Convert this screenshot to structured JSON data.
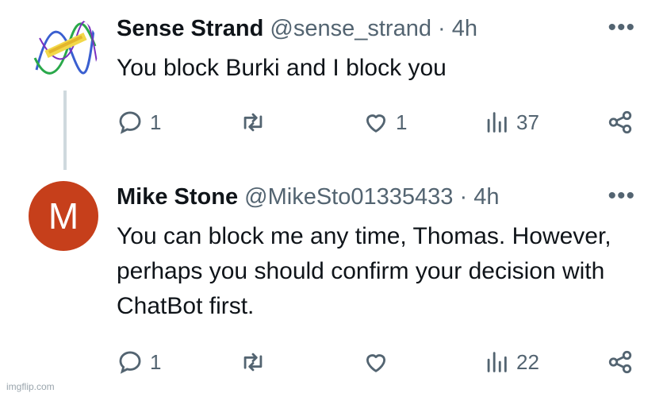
{
  "tweets": [
    {
      "name": "Sense Strand",
      "handle": "@sense_strand",
      "separator": "·",
      "time": "4h",
      "text": "You block Burki and I block you",
      "more": "•••",
      "replies": "1",
      "retweets": "",
      "likes": "1",
      "views": "37",
      "avatar_icon": "dna-helix-logo-icon"
    },
    {
      "name": "Mike Stone",
      "handle": "@MikeSto01335433",
      "separator": "·",
      "time": "4h",
      "text": "You can block me any time, Thomas. However, perhaps you should confirm your decision with ChatBot first.",
      "more": "•••",
      "replies": "1",
      "retweets": "",
      "likes": "",
      "views": "22",
      "avatar_letter": "M",
      "avatar_color": "#c63f1b"
    }
  ],
  "watermark": "imgflip.com"
}
